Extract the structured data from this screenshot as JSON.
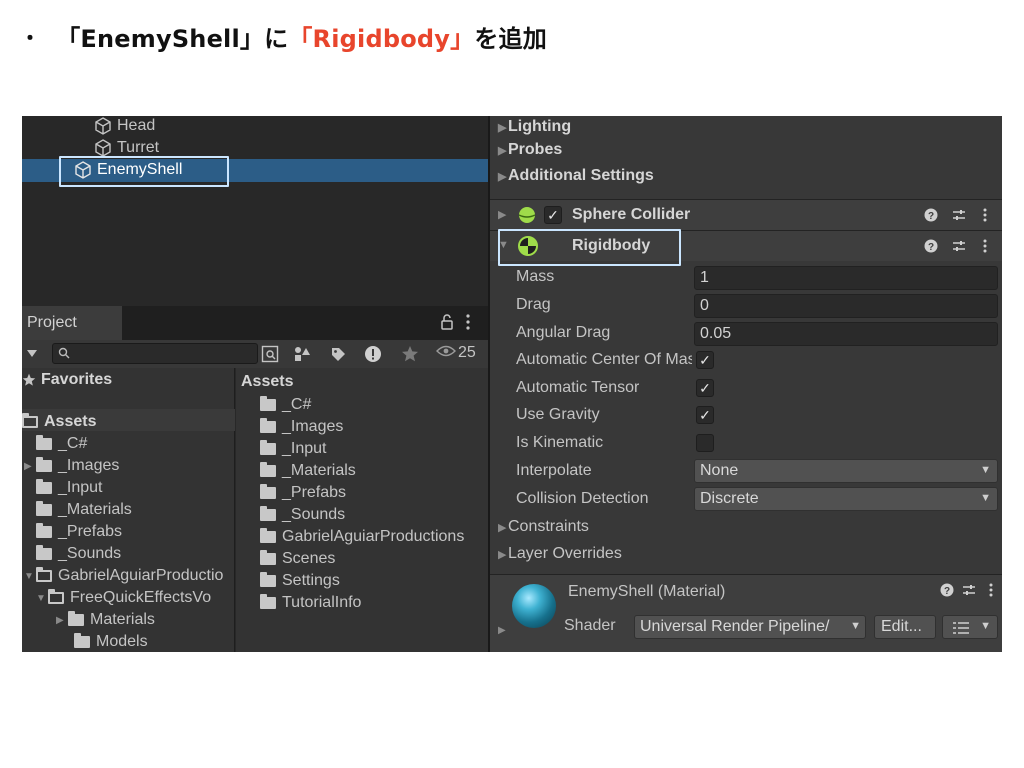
{
  "heading": {
    "bullet": "・",
    "part1": "「EnemyShell」に",
    "part2": "「Rigidbody」",
    "part3": "を追加",
    "accent_color": "#e8452c"
  },
  "hierarchy": {
    "items": [
      {
        "label": "Head",
        "icon": "cube-icon"
      },
      {
        "label": "Turret",
        "icon": "cube-icon"
      },
      {
        "label": "EnemyShell",
        "icon": "cube-icon",
        "selected": true
      }
    ]
  },
  "project": {
    "tab_label": "Project",
    "search_placeholder": "",
    "hidden_count": "25",
    "left_tree": {
      "favorites_label": "Favorites",
      "assets_label": "Assets",
      "items": [
        "_C#",
        "_Images",
        "_Input",
        "_Materials",
        "_Prefabs",
        "_Sounds",
        "GabrielAguiarProductio",
        "FreeQuickEffectsVo",
        "Materials",
        "Models"
      ]
    },
    "right_list": {
      "header": "Assets",
      "items": [
        "_C#",
        "_Images",
        "_Input",
        "_Materials",
        "_Prefabs",
        "_Sounds",
        "GabrielAguiarProductions",
        "Scenes",
        "Settings",
        "TutorialInfo"
      ]
    }
  },
  "inspector": {
    "sections": [
      "Lighting",
      "Probes",
      "Additional Settings"
    ],
    "sphere_collider": {
      "title": "Sphere Collider",
      "enabled": true
    },
    "rigidbody": {
      "title": "Rigidbody",
      "properties": {
        "mass_label": "Mass",
        "mass_value": "1",
        "drag_label": "Drag",
        "drag_value": "0",
        "angular_drag_label": "Angular Drag",
        "angular_drag_value": "0.05",
        "auto_center_label": "Automatic Center Of Mass",
        "auto_center_checked": true,
        "auto_tensor_label": "Automatic Tensor",
        "auto_tensor_checked": true,
        "use_gravity_label": "Use Gravity",
        "use_gravity_checked": true,
        "is_kinematic_label": "Is Kinematic",
        "is_kinematic_checked": false,
        "interpolate_label": "Interpolate",
        "interpolate_value": "None",
        "collision_label": "Collision Detection",
        "collision_value": "Discrete",
        "constraints_label": "Constraints",
        "layer_overrides_label": "Layer Overrides"
      }
    },
    "material": {
      "title": "EnemyShell (Material)",
      "shader_label": "Shader",
      "shader_value": "Universal Render Pipeline/",
      "edit_label": "Edit...",
      "list_icon": "list-icon"
    },
    "check_glyph": "✓",
    "help_glyph": "?",
    "settings_glyph": "⇄",
    "menu_glyph": "⋮"
  }
}
